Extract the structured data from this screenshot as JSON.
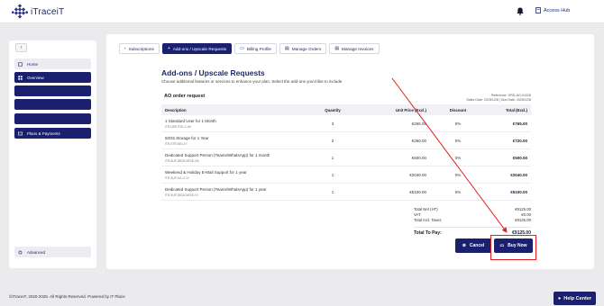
{
  "app": {
    "name": "iTraceiT",
    "access_hub": "Access Hub"
  },
  "sidebar": {
    "collapse": "‹",
    "items": [
      {
        "label": "Home",
        "active": false
      },
      {
        "label": "Overview",
        "active": true
      },
      {
        "label": "",
        "active": true
      },
      {
        "label": "",
        "active": true
      },
      {
        "label": "",
        "active": true
      },
      {
        "label": "Plans & Payments",
        "active": true
      },
      {
        "label": "Advanced",
        "active": false
      }
    ]
  },
  "tabs": [
    {
      "icon": "‹",
      "label": "Subscriptions"
    },
    {
      "icon": "+",
      "label": "Add-ons / Upscale Requests"
    },
    {
      "icon": "▭",
      "label": "Billing Profile"
    },
    {
      "icon": "▤",
      "label": "Manage Orders"
    },
    {
      "icon": "▤",
      "label": "Manage Invoices"
    }
  ],
  "page": {
    "title": "Add-ons / Upscale Requests",
    "subtitle": "Choose additional features or services to enhance your plan. Select the add-ons you'd like to include"
  },
  "order": {
    "title": "AO order request",
    "reference": "Reference: ORD-AO-01028",
    "dates": "Sales Date: 2025/12/8  |  Due Date: 2025/12/8"
  },
  "table": {
    "headers": {
      "desc": "Description",
      "qty": "Quantity",
      "unit": "Unit Price (Excl.)",
      "disc": "Discount",
      "total": "Total (Excl.)"
    },
    "rows": [
      {
        "name": "1 Standard User for 1 Month",
        "code": "ITR-USR-STD-1-1M",
        "qty": "3",
        "unit": "€255.00",
        "disc": "0%",
        "total": "€765.00"
      },
      {
        "name": "50Gb Storage for 1 Year",
        "code": "ITR-STR-50G-1Y",
        "qty": "2",
        "unit": "€360.00",
        "disc": "0%",
        "total": "€720.00"
      },
      {
        "name": "Dedicated Support Person (Teams/WhatsApp) for 1 month",
        "code": "ITR-SUP-DEDICATED-1M",
        "qty": "1",
        "unit": "€500.00",
        "disc": "0%",
        "total": "€500.00"
      },
      {
        "name": "Weekend & Holiday E-Mail Support for 1 year",
        "code": "ITR-SUP-LVL-2-1Y",
        "qty": "1",
        "unit": "€2040.00",
        "disc": "0%",
        "total": "€2040.00"
      },
      {
        "name": "Dedicated Support Person (Teams/WhatsApp) for 1 year",
        "code": "ITR-SUP-DEDICATED-1Y",
        "qty": "1",
        "unit": "€5100.00",
        "disc": "0%",
        "total": "€5100.00"
      }
    ]
  },
  "totals": {
    "net_label": "Total Net (HT)",
    "net": "€9125.00",
    "vat_label": "VAT",
    "vat": "€0.00",
    "incl_label": "Total Incl. Taxes",
    "incl": "€9125.00",
    "pay_label": "Total To Pay:",
    "pay": "€9125.00"
  },
  "buttons": {
    "cancel": "Cancel",
    "buy": "Buy Now"
  },
  "footer": {
    "copyright": "©iTraceiT, 2020-2025. All Rights Reserved. Powered by IT Place",
    "help": "Help Center"
  },
  "colors": {
    "primary": "#1a1f6e",
    "highlight": "#e02020"
  }
}
